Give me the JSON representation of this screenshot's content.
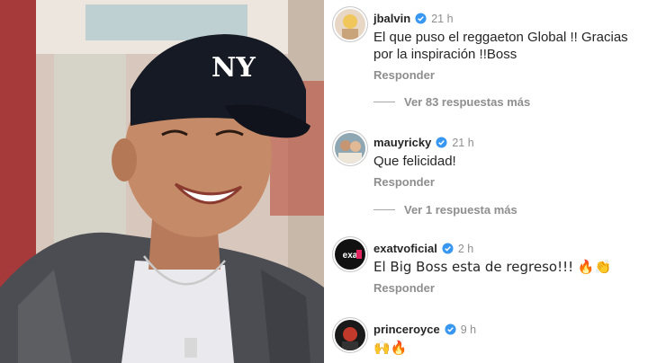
{
  "comments": [
    {
      "username": "jbalvin",
      "time": "21 h",
      "text": "El que puso el reggaeton Global !! Gracias por la inspiración !!Boss",
      "reply": "Responder"
    },
    {
      "username": "mauyricky",
      "time": "21 h",
      "text": "Que felicidad!",
      "reply": "Responder"
    },
    {
      "username": "exatvoficial",
      "time": "2 h",
      "text": "El Big Boss esta de regreso!!! 🔥👏",
      "reply": "Responder"
    },
    {
      "username": "princeroyce",
      "time": "9 h",
      "text": "🙌🔥",
      "reply": ""
    }
  ],
  "view_more": [
    "Ver 83 respuestas más",
    "Ver 1 respuesta más"
  ],
  "photo": {
    "cap_logo": "NY"
  },
  "colors": {
    "verified": "#3897f0",
    "secondary_text": "#8e8e8e",
    "primary_text": "#262626"
  }
}
